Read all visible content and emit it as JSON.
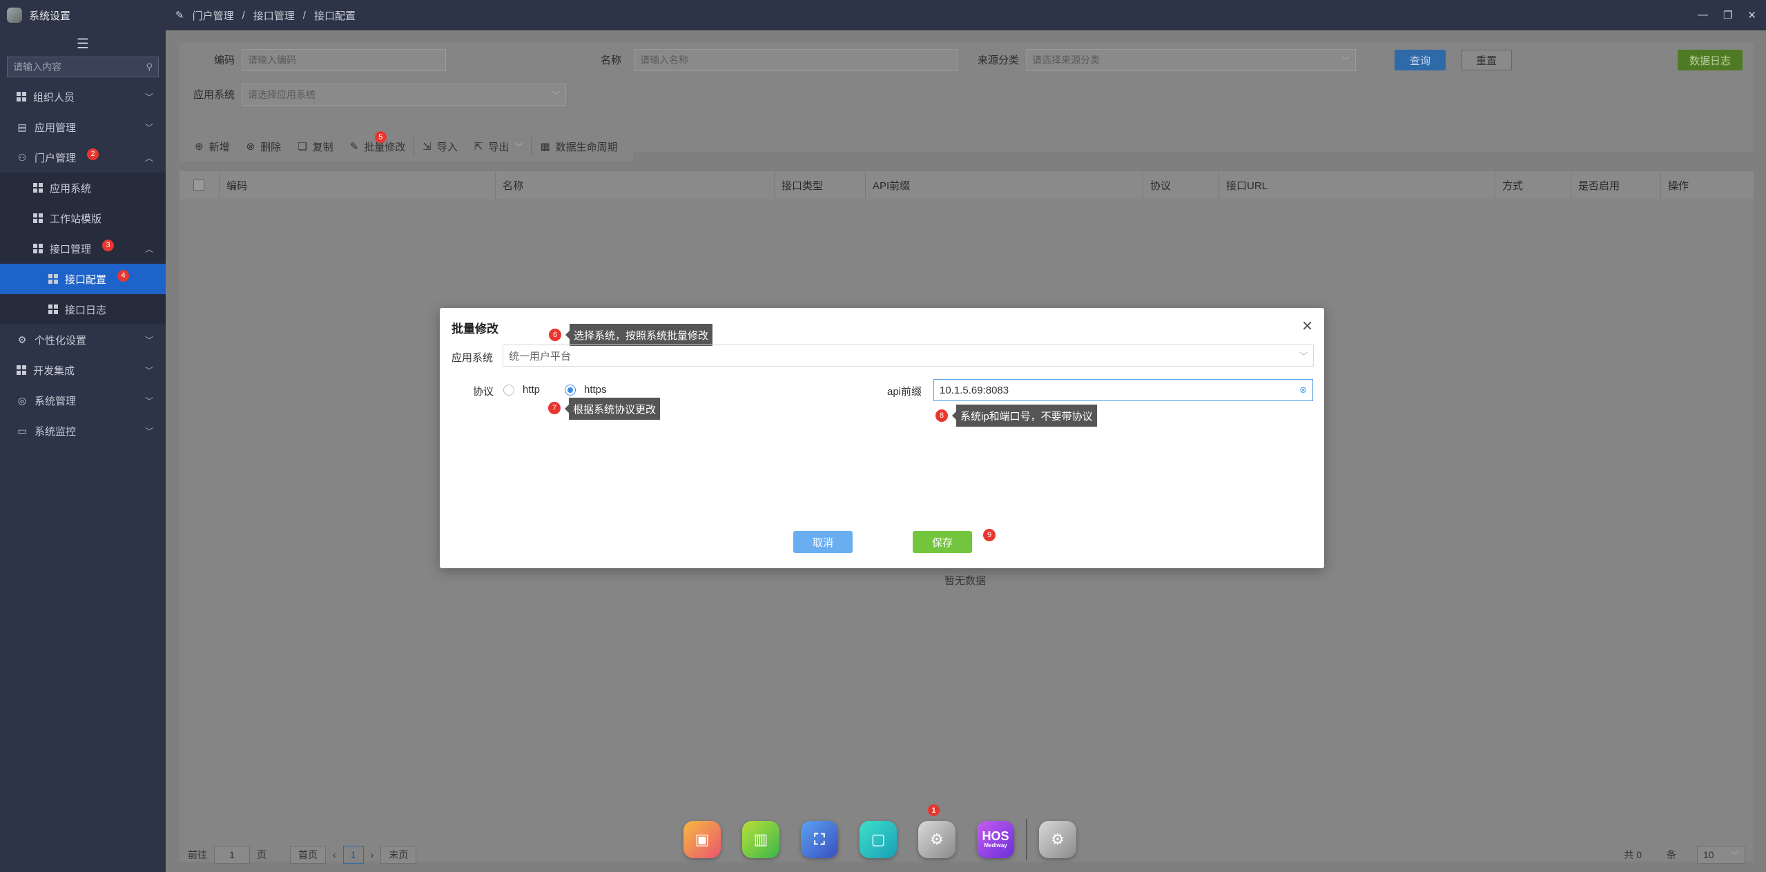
{
  "app": {
    "title": "系统设置"
  },
  "sidebar": {
    "search_placeholder": "请输入内容",
    "items": [
      {
        "label": "组织人员"
      },
      {
        "label": "应用管理"
      },
      {
        "label": "门户管理",
        "badge": "2"
      },
      {
        "label": "应用系统"
      },
      {
        "label": "工作站模版"
      },
      {
        "label": "接口管理",
        "badge": "3"
      },
      {
        "label": "接口配置",
        "badge": "4"
      },
      {
        "label": "接口日志"
      },
      {
        "label": "个性化设置"
      },
      {
        "label": "开发集成"
      },
      {
        "label": "系统管理"
      },
      {
        "label": "系统监控"
      }
    ]
  },
  "breadcrumb": {
    "items": [
      "门户管理",
      "接口管理",
      "接口配置"
    ],
    "sep": "/"
  },
  "filter": {
    "code_label": "编码",
    "code_placeholder": "请输入编码",
    "name_label": "名称",
    "name_placeholder": "请输入名称",
    "source_label": "来源分类",
    "source_placeholder": "请选择来源分类",
    "app_label": "应用系统",
    "app_placeholder": "请选择应用系统",
    "query_label": "查询",
    "reset_label": "重置",
    "log_label": "数据日志"
  },
  "toolbar": {
    "add": "新增",
    "delete": "删除",
    "copy": "复制",
    "batch_edit": "批量修改",
    "batch_badge": "5",
    "import": "导入",
    "export": "导出",
    "lifecycle": "数据生命周期"
  },
  "table": {
    "columns": [
      "编码",
      "名称",
      "接口类型",
      "API前缀",
      "协议",
      "接口URL",
      "方式",
      "是否启用",
      "操作"
    ],
    "empty": "暂无数据"
  },
  "pager": {
    "goto": "前往",
    "page_input": "1",
    "page_unit": "页",
    "first": "首页",
    "current": "1",
    "last": "末页",
    "total": "共 0",
    "per_unit": "条",
    "size": "10"
  },
  "dock": {
    "badge": "1",
    "hos_text": "HOS",
    "hos_sub": "Mediway"
  },
  "modal": {
    "title": "批量修改",
    "app_label": "应用系统",
    "app_value": "统一用户平台",
    "protocol_label": "协议",
    "opt_http": "http",
    "opt_https": "https",
    "api_label": "api前缀",
    "api_value": "10.1.5.69:8083",
    "cancel": "取消",
    "save": "保存",
    "tips": {
      "n6": "6",
      "t6": "选择系统，按照系统批量修改",
      "n7": "7",
      "t7": "根据系统协议更改",
      "n8": "8",
      "t8": "系统ip和端口号，不要带协议",
      "n9": "9"
    }
  }
}
